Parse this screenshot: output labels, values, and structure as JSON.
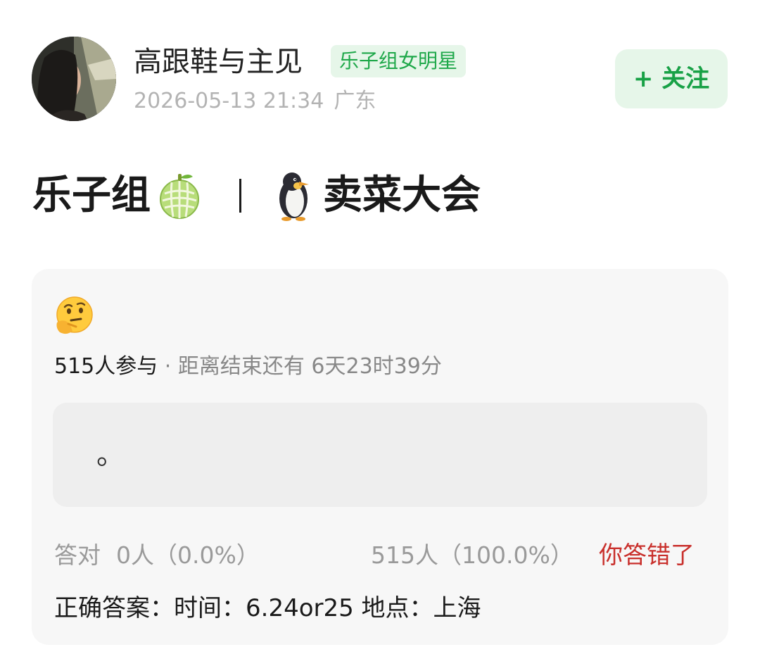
{
  "post": {
    "author": {
      "name": "高跟鞋与主见",
      "badge": "乐子组女明星"
    },
    "timestamp": "2026-05-13 21:34",
    "location": "广东",
    "follow_label": "+ 关注",
    "title": {
      "left": "乐子组",
      "right": "卖菜大会",
      "left_emoji": "melon",
      "right_emoji": "penguin"
    }
  },
  "quiz": {
    "emoji": "thinking-face",
    "participants": "515人参与",
    "separator": " · ",
    "countdown": "距离结束还有 6天23时39分",
    "option_text": "。",
    "correct_label": "答对",
    "correct_stat": "0人（0.0%）",
    "option_stat": "515人（100.0%）",
    "result": "你答错了",
    "answer": "正确答案：时间：6.24or25 地点：上海"
  },
  "colors": {
    "accent_green": "#18a146",
    "badge_bg": "#e6f6e9",
    "wrong_red": "#c9302c",
    "card_bg": "#f7f7f7",
    "option_bg": "#eeeeee"
  }
}
